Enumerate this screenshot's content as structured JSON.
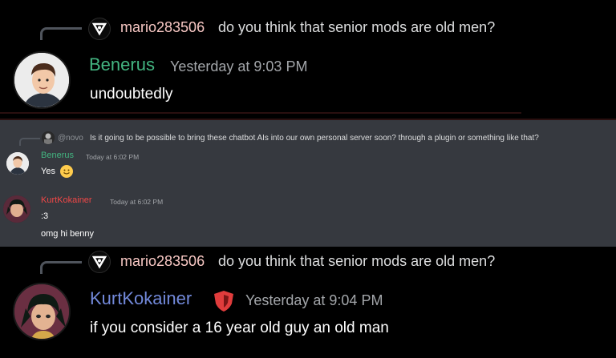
{
  "top_message": {
    "reply_user": "mario283506",
    "reply_text": "do you think that senior mods are old men?",
    "author": "Benerus",
    "author_color": "#43b581",
    "timestamp": "Yesterday at 9:03 PM",
    "content": "undoubtedly"
  },
  "embedded_screenshot": {
    "reply_user": "@novo",
    "reply_text": "Is it going to be possible to bring these chatbot AIs into our own personal server soon? through a plugin or something like that?",
    "messages": [
      {
        "author": "Benerus",
        "author_color": "#43b581",
        "timestamp": "Today at 6:02 PM",
        "content": "Yes"
      },
      {
        "author": "KurtKokainer",
        "author_color": "#f04747",
        "timestamp": "Today at 6:02 PM",
        "content": ":3",
        "content2": "omg hi benny"
      }
    ]
  },
  "bottom_message": {
    "reply_user": "mario283506",
    "reply_text": "do you think that senior mods are old men?",
    "author": "KurtKokainer",
    "author_color": "#7289da",
    "timestamp": "Yesterday at 9:04 PM",
    "content": "if you consider a 16 year old guy an old man"
  }
}
